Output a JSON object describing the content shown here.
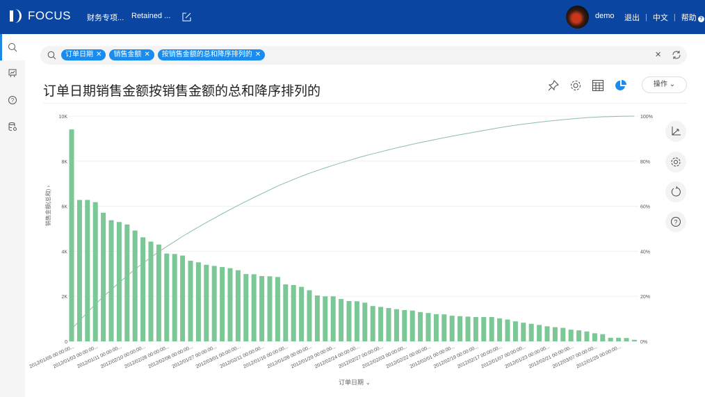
{
  "header": {
    "brand": "FOCUS",
    "nav": [
      "财务专项...",
      "Retained ..."
    ],
    "user": "demo",
    "logout": "退出",
    "language": "中文",
    "help": "帮助"
  },
  "search": {
    "chips": [
      "订单日期",
      "销售金额",
      "按销售金额的总和降序排列的"
    ]
  },
  "page": {
    "title": "订单日期销售金额按销售金额的总和降序排列的",
    "action_button": "操作"
  },
  "colors": {
    "header": "#0a46a1",
    "chip": "#1a8cf0",
    "bar": "#7bc896",
    "line": "#8bbfa0"
  },
  "chart_data": {
    "type": "bar+line",
    "xlabel": "订单日期",
    "ylabel": "销售金额(总和)",
    "ylim": [
      0,
      10000
    ],
    "y_ticks": [
      "0",
      "2K",
      "4K",
      "6K",
      "8K",
      "10K"
    ],
    "y2lim": [
      0,
      100
    ],
    "y2_ticks": [
      "0%",
      "20%",
      "40%",
      "60%",
      "80%",
      "100%"
    ],
    "x_tick_labels": [
      "2012/01/05 00:00:00...",
      "2012/01/03 00:00:00...",
      "2012/01/11 00:00:00...",
      "2012/02/10 00:00:00...",
      "2012/02/28 00:00:00...",
      "2012/02/08 00:00:00...",
      "2012/01/27 00:00:00...",
      "2012/03/01 00:00:00...",
      "2012/02/11 00:00:00...",
      "2012/01/16 00:00:00...",
      "2012/01/28 00:00:00...",
      "2012/01/29 00:00:00...",
      "2012/02/24 00:00:00...",
      "2012/02/27 00:00:00...",
      "2012/02/03 00:00:00...",
      "2012/02/22 00:00:00...",
      "2012/02/01 00:00:00...",
      "2012/02/19 00:00:00...",
      "2012/02/17 00:00:00...",
      "2012/01/07 00:00:00...",
      "2012/01/23 00:00:00...",
      "2012/02/21 00:00:00...",
      "2012/03/07 00:00:00...",
      "2012/01/25 00:00:00..."
    ],
    "values": [
      9410,
      6280,
      6280,
      6180,
      5710,
      5380,
      5300,
      5190,
      4920,
      4620,
      4430,
      4300,
      3900,
      3880,
      3810,
      3580,
      3510,
      3400,
      3350,
      3300,
      3250,
      3160,
      2990,
      2980,
      2900,
      2890,
      2860,
      2530,
      2500,
      2420,
      2270,
      2040,
      2000,
      2000,
      1880,
      1790,
      1780,
      1720,
      1570,
      1530,
      1480,
      1430,
      1390,
      1370,
      1300,
      1260,
      1210,
      1200,
      1140,
      1120,
      1100,
      1080,
      1080,
      1080,
      1020,
      970,
      890,
      830,
      780,
      730,
      670,
      630,
      600,
      520,
      490,
      440,
      360,
      320,
      160,
      160,
      150,
      70
    ],
    "line": "cumulative percent of total",
    "grid": true
  }
}
